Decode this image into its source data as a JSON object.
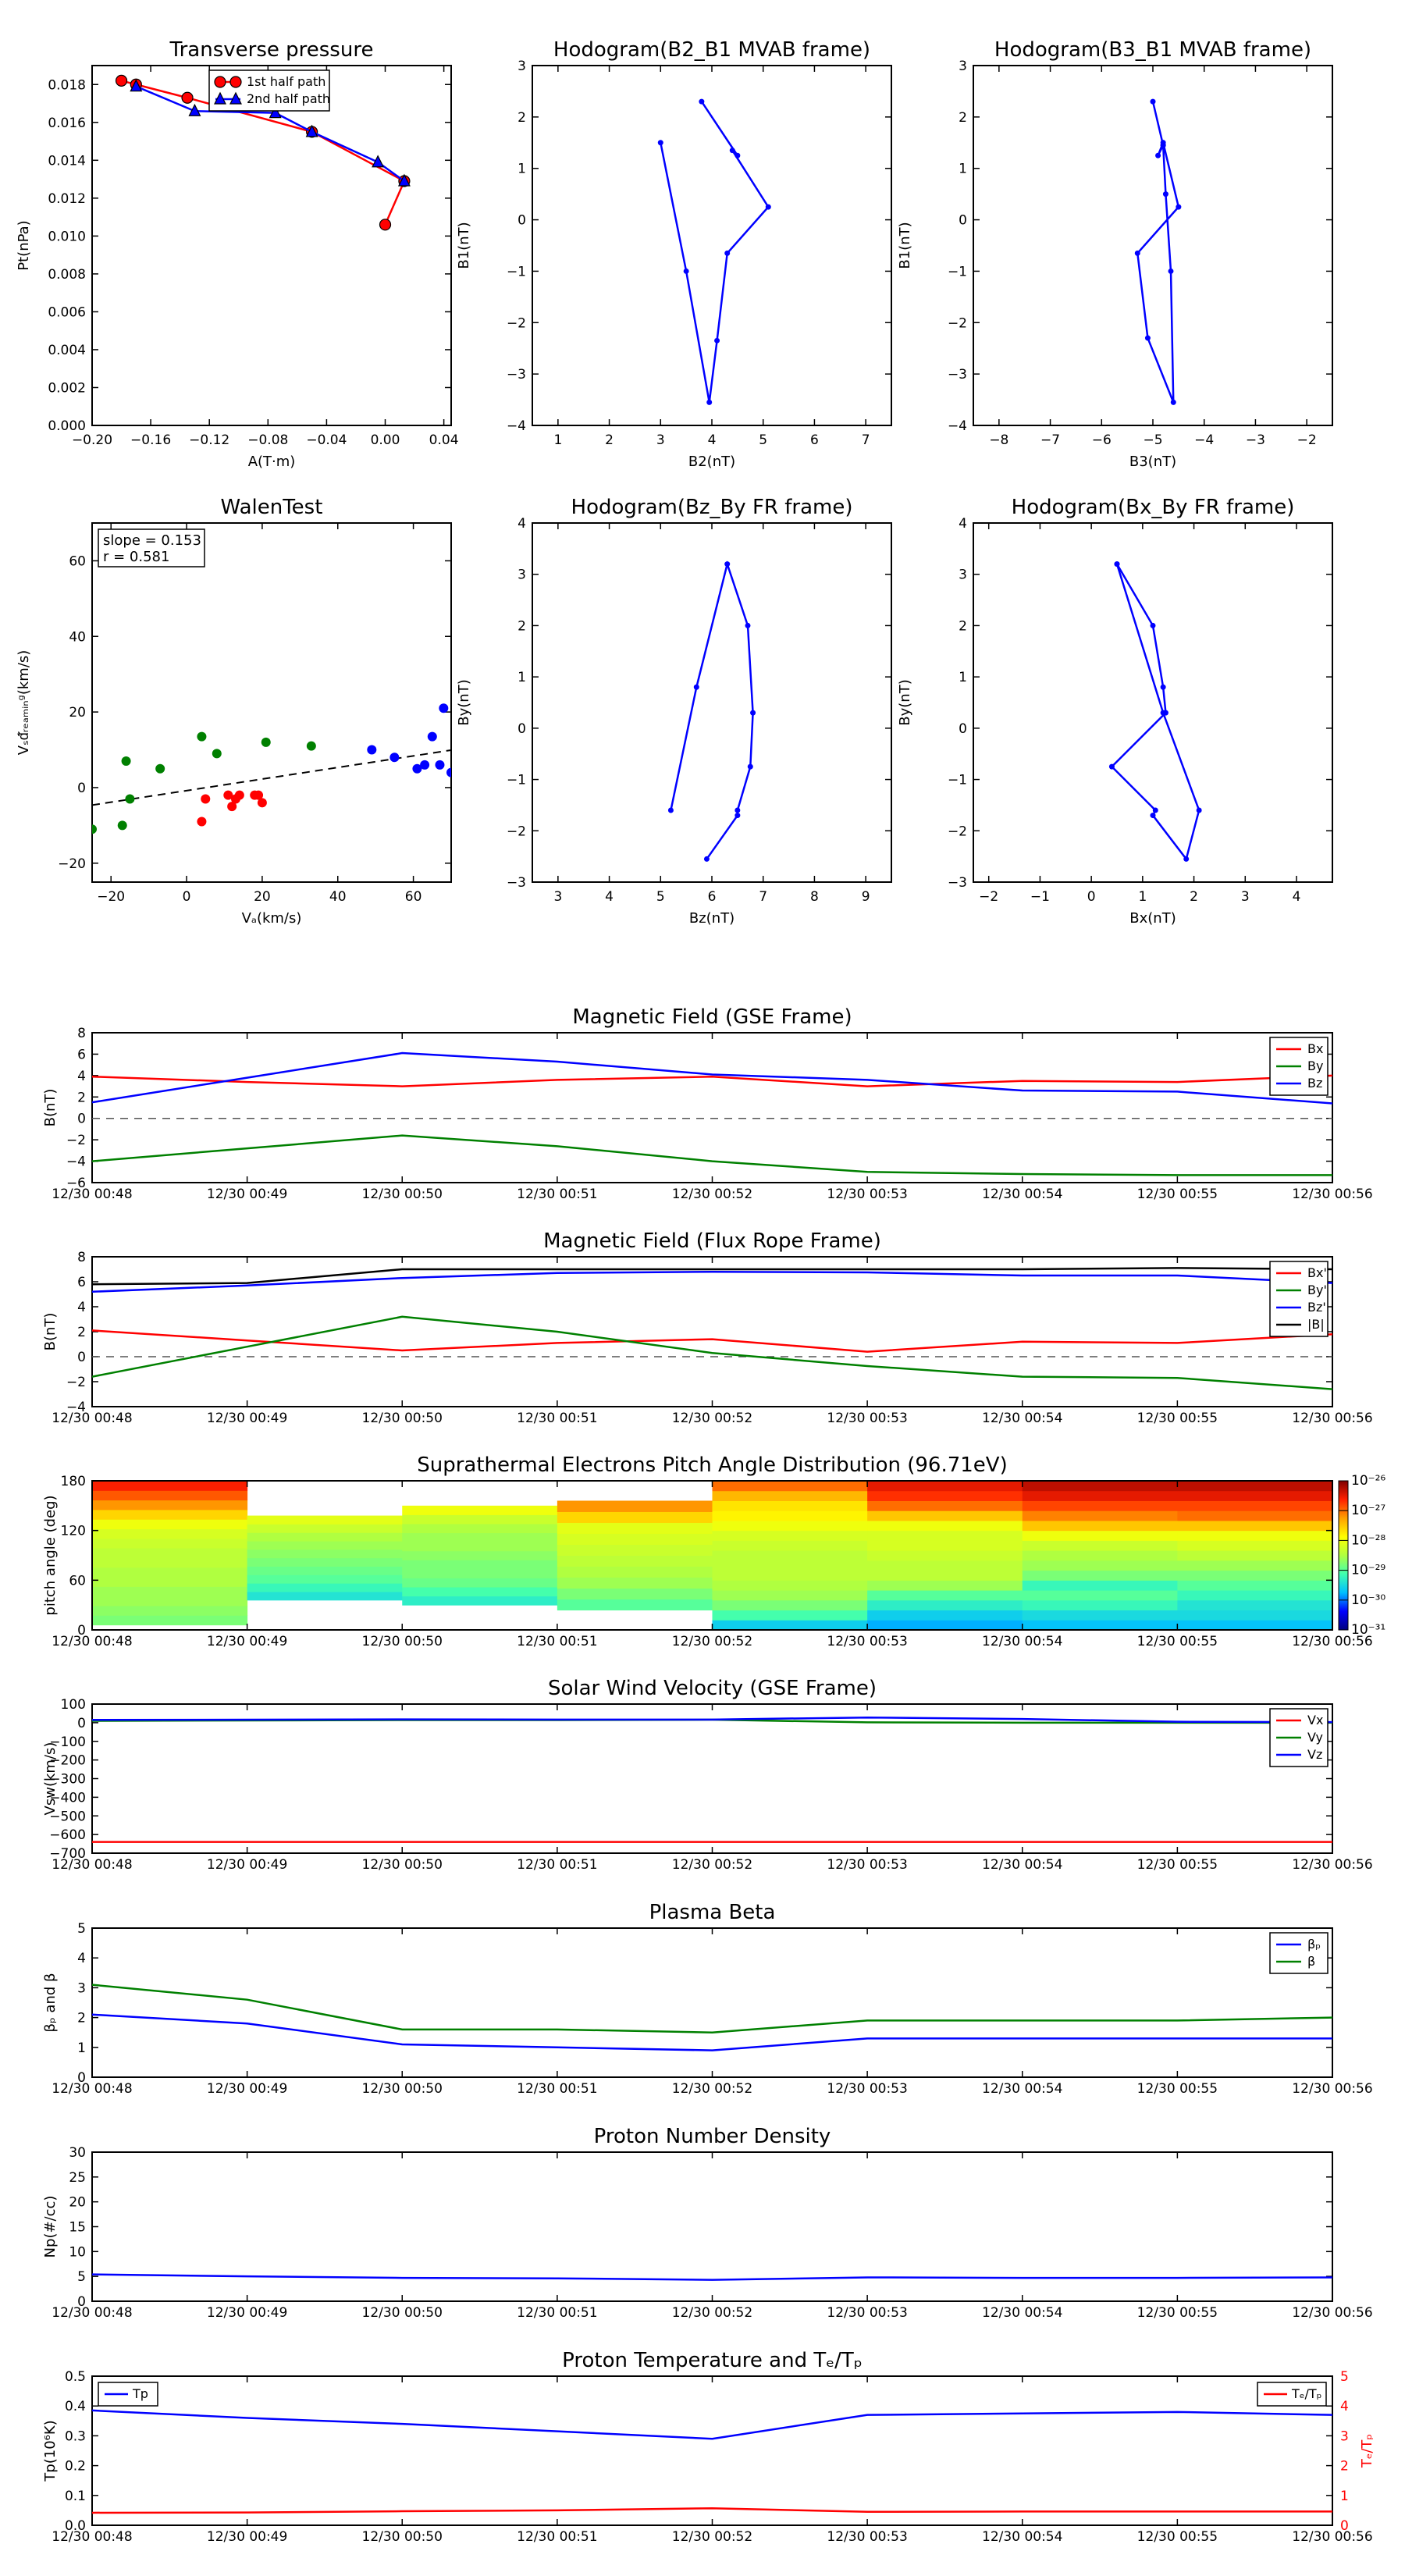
{
  "figure": {
    "background": "#ffffff"
  },
  "chart_data": [
    {
      "id": "transverse_pressure",
      "type": "line",
      "title": "Transverse pressure",
      "xlabel": "A(T·m)",
      "ylabel": "Pt(nPa)",
      "xlim": [
        -0.2,
        0.045
      ],
      "ylim": [
        0,
        0.019
      ],
      "xticks": [
        -0.2,
        -0.16,
        -0.12,
        -0.08,
        -0.04,
        0.0,
        0.04
      ],
      "xticklabels": [
        "−0.20",
        "−0.16",
        "−0.12",
        "−0.08",
        "−0.04",
        "0.00",
        "0.04"
      ],
      "yticks": [
        0,
        0.002,
        0.004,
        0.006,
        0.008,
        0.01,
        0.012,
        0.014,
        0.016,
        0.018
      ],
      "yticklabels": [
        "0.000",
        "0.002",
        "0.004",
        "0.006",
        "0.008",
        "0.010",
        "0.012",
        "0.014",
        "0.016",
        "0.018"
      ],
      "legend_position": "top-center",
      "series": [
        {
          "name": "1st half path",
          "color": "#ff0000",
          "marker": "circle",
          "x": [
            -0.18,
            -0.17,
            -0.135,
            -0.05,
            0.013,
            0.0
          ],
          "y": [
            0.0182,
            0.018,
            0.0173,
            0.0155,
            0.0129,
            0.0106
          ]
        },
        {
          "name": "2nd half path",
          "color": "#0000ff",
          "marker": "triangle",
          "x": [
            -0.17,
            -0.13,
            -0.075,
            -0.05,
            -0.005,
            0.013
          ],
          "y": [
            0.0179,
            0.0166,
            0.0165,
            0.0155,
            0.0139,
            0.0129
          ]
        }
      ]
    },
    {
      "id": "hodogram_b2b1",
      "type": "line",
      "title": "Hodogram(B2_B1 MVAB frame)",
      "xlabel": "B2(nT)",
      "ylabel": "B1(nT)",
      "xlim": [
        0.5,
        7.5
      ],
      "ylim": [
        -4,
        3
      ],
      "xticks": [
        1,
        2,
        3,
        4,
        5,
        6,
        7
      ],
      "xticklabels": [
        "1",
        "2",
        "3",
        "4",
        "5",
        "6",
        "7"
      ],
      "yticks": [
        -4,
        -3,
        -2,
        -1,
        0,
        1,
        2,
        3
      ],
      "yticklabels": [
        "−4",
        "−3",
        "−2",
        "−1",
        "0",
        "1",
        "2",
        "3"
      ],
      "series": [
        {
          "color": "#0000ff",
          "marker": "dot",
          "x": [
            3.8,
            4.5,
            4.4,
            5.1,
            4.3,
            4.1,
            3.95,
            3.5,
            3.0
          ],
          "y": [
            2.3,
            1.25,
            1.35,
            0.25,
            -0.65,
            -2.35,
            -3.55,
            -1.0,
            1.5
          ]
        }
      ]
    },
    {
      "id": "hodogram_b3b1",
      "type": "line",
      "title": "Hodogram(B3_B1 MVAB frame)",
      "xlabel": "B3(nT)",
      "ylabel": "B1(nT)",
      "xlim": [
        -8.5,
        -1.5
      ],
      "ylim": [
        -4,
        3
      ],
      "xticks": [
        -8,
        -7,
        -6,
        -5,
        -4,
        -3,
        -2
      ],
      "xticklabels": [
        "−8",
        "−7",
        "−6",
        "−5",
        "−4",
        "−3",
        "−2"
      ],
      "yticks": [
        -4,
        -3,
        -2,
        -1,
        0,
        1,
        2,
        3
      ],
      "yticklabels": [
        "−4",
        "−3",
        "−2",
        "−1",
        "0",
        "1",
        "2",
        "3"
      ],
      "series": [
        {
          "color": "#0000ff",
          "marker": "dot",
          "x": [
            -5.0,
            -4.8,
            -4.9,
            -4.8,
            -4.5,
            -5.3,
            -5.1,
            -4.6,
            -4.65,
            -4.75,
            -4.8
          ],
          "y": [
            2.3,
            1.45,
            1.25,
            1.5,
            0.25,
            -0.65,
            -2.3,
            -3.55,
            -1.0,
            0.5,
            1.45
          ]
        }
      ]
    },
    {
      "id": "walen_test",
      "type": "scatter",
      "title": "WalenTest",
      "xlabel": "Vₐ(km/s)",
      "ylabel": "Vₛᵭᵣₑₐₘᵢₙᵍ(km/s)",
      "xlim": [
        -25,
        70
      ],
      "ylim": [
        -25,
        70
      ],
      "xticks": [
        -20,
        0,
        20,
        40,
        60
      ],
      "xticklabels": [
        "−20",
        "0",
        "20",
        "40",
        "60"
      ],
      "yticks": [
        -20,
        0,
        20,
        40,
        60
      ],
      "yticklabels": [
        "−20",
        "0",
        "20",
        "40",
        "60"
      ],
      "annotation": [
        "slope = 0.153",
        "r = 0.581"
      ],
      "fit_line": {
        "slope": 0.153,
        "intercept": -0.8
      },
      "series": [
        {
          "color": "#008000",
          "x": [
            -25,
            -17,
            -15,
            -16,
            -7,
            4,
            8,
            21,
            33
          ],
          "y": [
            -11,
            -10,
            -3,
            7,
            5,
            13.5,
            9,
            12,
            11
          ]
        },
        {
          "color": "#ff0000",
          "x": [
            4,
            5,
            11,
            12,
            13,
            14,
            18,
            19,
            20
          ],
          "y": [
            -9,
            -3,
            -2,
            -5,
            -3,
            -2,
            -2,
            -2,
            -4
          ]
        },
        {
          "color": "#0000ff",
          "x": [
            49,
            55,
            61,
            63,
            65,
            67,
            68,
            70
          ],
          "y": [
            10,
            8,
            5,
            6,
            13.5,
            6,
            21,
            4
          ]
        }
      ]
    },
    {
      "id": "hodogram_bzby",
      "type": "line",
      "title": "Hodogram(Bz_By FR frame)",
      "xlabel": "Bz(nT)",
      "ylabel": "By(nT)",
      "xlim": [
        2.5,
        9.5
      ],
      "ylim": [
        -3,
        4
      ],
      "xticks": [
        3,
        4,
        5,
        6,
        7,
        8,
        9
      ],
      "xticklabels": [
        "3",
        "4",
        "5",
        "6",
        "7",
        "8",
        "9"
      ],
      "yticks": [
        -3,
        -2,
        -1,
        0,
        1,
        2,
        3,
        4
      ],
      "yticklabels": [
        "−3",
        "−2",
        "−1",
        "0",
        "1",
        "2",
        "3",
        "4"
      ],
      "series": [
        {
          "color": "#0000ff",
          "marker": "dot",
          "x": [
            5.2,
            5.7,
            6.3,
            6.7,
            6.8,
            6.75,
            6.5,
            6.5,
            5.9
          ],
          "y": [
            -1.6,
            0.8,
            3.2,
            2.0,
            0.3,
            -0.75,
            -1.6,
            -1.7,
            -2.55
          ]
        }
      ]
    },
    {
      "id": "hodogram_bxby",
      "type": "line",
      "title": "Hodogram(Bx_By FR frame)",
      "xlabel": "Bx(nT)",
      "ylabel": "By(nT)",
      "xlim": [
        -2.3,
        4.7
      ],
      "ylim": [
        -3,
        4
      ],
      "xticks": [
        -2,
        -1,
        0,
        1,
        2,
        3,
        4
      ],
      "xticklabels": [
        "−2",
        "−1",
        "0",
        "1",
        "2",
        "3",
        "4"
      ],
      "yticks": [
        -3,
        -2,
        -1,
        0,
        1,
        2,
        3,
        4
      ],
      "yticklabels": [
        "−3",
        "−2",
        "−1",
        "0",
        "1",
        "2",
        "3",
        "4"
      ],
      "series": [
        {
          "color": "#0000ff",
          "marker": "dot",
          "x": [
            0.5,
            1.2,
            1.4,
            1.45,
            0.4,
            1.25,
            1.2,
            1.85,
            2.1,
            1.4,
            0.5
          ],
          "y": [
            3.2,
            2.0,
            0.8,
            0.3,
            -0.75,
            -1.6,
            -1.7,
            -2.55,
            -1.6,
            0.3,
            3.2
          ]
        }
      ]
    },
    {
      "id": "mag_gse",
      "type": "line",
      "title": "Magnetic Field (GSE Frame)",
      "ylabel": "B(nT)",
      "ylim": [
        -6,
        8
      ],
      "yticks": [
        -6,
        -4,
        -2,
        0,
        2,
        4,
        6,
        8
      ],
      "yticklabels": [
        "−6",
        "−4",
        "−2",
        "0",
        "2",
        "4",
        "6",
        "8"
      ],
      "zero_line": true,
      "legend_position": "top-right",
      "series": [
        {
          "name": "Bx",
          "color": "#ff0000",
          "values": [
            3.9,
            3.4,
            3.0,
            3.6,
            3.9,
            3.0,
            3.5,
            3.4,
            4.0
          ]
        },
        {
          "name": "By",
          "color": "#008000",
          "values": [
            -4.0,
            -2.8,
            -1.6,
            -2.6,
            -4.0,
            -5.0,
            -5.2,
            -5.3,
            -5.3
          ]
        },
        {
          "name": "Bz",
          "color": "#0000ff",
          "values": [
            1.5,
            3.8,
            6.1,
            5.3,
            4.1,
            3.6,
            2.6,
            2.5,
            1.4
          ]
        }
      ]
    },
    {
      "id": "mag_fr",
      "type": "line",
      "title": "Magnetic Field (Flux Rope Frame)",
      "ylabel": "B(nT)",
      "ylim": [
        -4,
        8
      ],
      "yticks": [
        -4,
        -2,
        0,
        2,
        4,
        6,
        8
      ],
      "yticklabels": [
        "−4",
        "−2",
        "0",
        "2",
        "4",
        "6",
        "8"
      ],
      "zero_line": true,
      "legend_position": "top-right",
      "series": [
        {
          "name": "Bx'",
          "color": "#ff0000",
          "values": [
            2.1,
            1.3,
            0.5,
            1.1,
            1.4,
            0.4,
            1.2,
            1.1,
            1.8
          ]
        },
        {
          "name": "By'",
          "color": "#008000",
          "values": [
            -1.6,
            0.8,
            3.2,
            2.0,
            0.3,
            -0.75,
            -1.6,
            -1.7,
            -2.6
          ]
        },
        {
          "name": "Bz'",
          "color": "#0000ff",
          "values": [
            5.2,
            5.7,
            6.3,
            6.7,
            6.8,
            6.75,
            6.5,
            6.5,
            5.9
          ]
        },
        {
          "name": "|B|",
          "color": "#000000",
          "values": [
            5.8,
            5.9,
            7.0,
            7.0,
            7.0,
            7.0,
            7.0,
            7.1,
            7.0
          ]
        }
      ]
    },
    {
      "id": "pad",
      "type": "heatmap",
      "title": "Suprathermal Electrons Pitch Angle Distribution (96.71eV)",
      "ylabel": "pitch angle (deg)",
      "ylim": [
        0,
        180
      ],
      "yticks": [
        0,
        60,
        120,
        180
      ],
      "yticklabels": [
        "0",
        "60",
        "120",
        "180"
      ],
      "colorbar_ticklabels": [
        "10⁻²⁶",
        "10⁻²⁷",
        "10⁻²⁸",
        "10⁻²⁹",
        "10⁻³⁰",
        "10⁻³¹"
      ],
      "colorbar_range_exponents": [
        -31,
        -26
      ],
      "colorbar_stops": [
        "#00007f",
        "#0000ff",
        "#00bfff",
        "#40ffb0",
        "#b0ff40",
        "#ffff00",
        "#ffa000",
        "#ff2000",
        "#7f0000"
      ],
      "columns": [
        {
          "bottom": 6,
          "top": 180,
          "values_exp": [
            -28.8,
            -28.7,
            -28.6,
            -28.6,
            -28.5,
            -28.5,
            -28.4,
            -28.4,
            -28.3,
            -28.2,
            -28.0,
            -27.6,
            -27.2,
            -26.9,
            -26.6
          ]
        },
        {
          "bottom": 36,
          "top": 138,
          "values_exp": [
            -29.4,
            -29.2,
            -29.0,
            -28.9,
            -28.8,
            -28.7,
            -28.6,
            -28.5,
            -28.3,
            -28.1
          ]
        },
        {
          "bottom": 30,
          "top": 150,
          "values_exp": [
            -29.3,
            -29.1,
            -28.9,
            -28.8,
            -28.8,
            -28.7,
            -28.6,
            -28.6,
            -28.5,
            -28.3,
            -28.0
          ]
        },
        {
          "bottom": 24,
          "top": 156,
          "values_exp": [
            -29.0,
            -28.8,
            -28.6,
            -28.5,
            -28.4,
            -28.3,
            -28.2,
            -28.1,
            -27.6,
            -27.2
          ]
        },
        {
          "bottom": 0,
          "top": 180,
          "values_exp": [
            -29.6,
            -29.1,
            -28.8,
            -28.6,
            -28.5,
            -28.4,
            -28.4,
            -28.4,
            -28.3,
            -28.2,
            -28.0,
            -27.8,
            -27.7,
            -27.4,
            -27.0
          ]
        },
        {
          "bottom": 0,
          "top": 180,
          "values_exp": [
            -29.8,
            -29.6,
            -29.3,
            -29.0,
            -28.6,
            -28.4,
            -28.4,
            -28.3,
            -28.2,
            -28.2,
            -28.0,
            -27.5,
            -27.0,
            -26.7,
            -26.5
          ]
        },
        {
          "bottom": 0,
          "top": 180,
          "values_exp": [
            -29.7,
            -29.5,
            -29.2,
            -29.0,
            -29.2,
            -28.8,
            -28.6,
            -28.5,
            -28.3,
            -28.0,
            -27.5,
            -27.1,
            -26.8,
            -26.5,
            -26.3
          ]
        },
        {
          "bottom": 0,
          "top": 180,
          "values_exp": [
            -29.7,
            -29.5,
            -29.4,
            -29.2,
            -29.0,
            -28.8,
            -28.6,
            -28.4,
            -28.2,
            -28.0,
            -27.5,
            -27.0,
            -26.8,
            -26.5,
            -26.3
          ]
        }
      ]
    },
    {
      "id": "vsw",
      "type": "line",
      "title": "Solar Wind Velocity (GSE Frame)",
      "ylabel": "Vsw(km/s)",
      "ylim": [
        -700,
        100
      ],
      "yticks": [
        -700,
        -600,
        -500,
        -400,
        -300,
        -200,
        -100,
        0,
        100
      ],
      "yticklabels": [
        "−700",
        "−600",
        "−500",
        "−400",
        "−300",
        "−200",
        "−100",
        "0",
        "100"
      ],
      "legend_position": "top-right",
      "series": [
        {
          "name": "Vx",
          "color": "#ff0000",
          "values": [
            -640,
            -640,
            -640,
            -640,
            -640,
            -640,
            -640,
            -640,
            -640
          ]
        },
        {
          "name": "Vy",
          "color": "#008000",
          "values": [
            10,
            12,
            14,
            14,
            16,
            2,
            0,
            0,
            0
          ]
        },
        {
          "name": "Vz",
          "color": "#0000ff",
          "values": [
            15,
            16,
            18,
            17,
            17,
            28,
            20,
            5,
            3
          ]
        }
      ]
    },
    {
      "id": "beta",
      "type": "line",
      "title": "Plasma Beta",
      "ylabel": "βₚ and β",
      "ylim": [
        0,
        5
      ],
      "yticks": [
        0,
        1,
        2,
        3,
        4,
        5
      ],
      "yticklabels": [
        "0",
        "1",
        "2",
        "3",
        "4",
        "5"
      ],
      "legend_position": "top-right",
      "series": [
        {
          "name": "βₚ",
          "color": "#0000ff",
          "values": [
            2.1,
            1.8,
            1.1,
            1.0,
            0.9,
            1.3,
            1.3,
            1.3,
            1.3
          ]
        },
        {
          "name": "β",
          "color": "#008000",
          "values": [
            3.1,
            2.6,
            1.6,
            1.6,
            1.5,
            1.9,
            1.9,
            1.9,
            2.0
          ]
        }
      ]
    },
    {
      "id": "np",
      "type": "line",
      "title": "Proton Number Density",
      "ylabel": "Np(#/cc)",
      "ylim": [
        0,
        30
      ],
      "yticks": [
        0,
        5,
        10,
        15,
        20,
        25,
        30
      ],
      "yticklabels": [
        "0",
        "5",
        "10",
        "15",
        "20",
        "25",
        "30"
      ],
      "series": [
        {
          "color": "#0000ff",
          "values": [
            5.4,
            5.0,
            4.7,
            4.6,
            4.3,
            4.8,
            4.7,
            4.7,
            4.8
          ]
        }
      ]
    },
    {
      "id": "temp",
      "type": "line",
      "title": "Proton Temperature and Tₑ/Tₚ",
      "ylabel": "Tp(10⁶K)",
      "ylim": [
        0,
        0.5
      ],
      "yticks": [
        0,
        0.1,
        0.2,
        0.3,
        0.4,
        0.5
      ],
      "yticklabels": [
        "0.0",
        "0.1",
        "0.2",
        "0.3",
        "0.4",
        "0.5"
      ],
      "y2label": "Tₑ/Tₚ",
      "y2lim": [
        0,
        5
      ],
      "y2ticks": [
        0,
        1,
        2,
        3,
        4,
        5
      ],
      "y2ticklabels": [
        "0",
        "1",
        "2",
        "3",
        "4",
        "5"
      ],
      "series": [
        {
          "name": "Tp",
          "color": "#0000ff",
          "axis": "left",
          "values": [
            0.385,
            0.36,
            0.34,
            0.315,
            0.29,
            0.37,
            0.375,
            0.38,
            0.37
          ]
        },
        {
          "name": "Tₑ/Tₚ",
          "color": "#ff0000",
          "axis": "right",
          "values": [
            0.42,
            0.43,
            0.47,
            0.5,
            0.57,
            0.45,
            0.46,
            0.46,
            0.46
          ]
        }
      ]
    }
  ],
  "time_axis": {
    "xticklabels": [
      "12/30 00:48",
      "12/30 00:49",
      "12/30 00:50",
      "12/30 00:51",
      "12/30 00:52",
      "12/30 00:53",
      "12/30 00:54",
      "12/30 00:55",
      "12/30 00:56"
    ]
  }
}
